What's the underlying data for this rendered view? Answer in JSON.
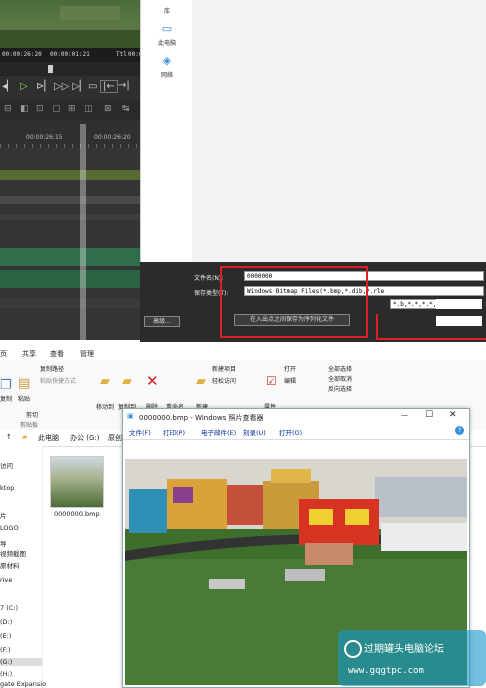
{
  "editor": {
    "timecodes": [
      "00:00:26:20",
      "00:00:01:21",
      "Ttl",
      "00:00:"
    ],
    "ruler_labels": [
      "00:00:26:15",
      "00:00:26:20"
    ]
  },
  "save_dialog": {
    "nav_items": [
      "库",
      "此电脑",
      "网络"
    ],
    "filename_label": "文件名(N):",
    "filename_value": "0000000",
    "filetype_label": "保存类型(T):",
    "filetype_value": "Windows Bitmap Files(*.bmp,*.dib,*.rle",
    "filter_value": "*.b,*.*,*.*,",
    "advanced_button": "高级...",
    "save_as_sequence_button": "在入出点之间保存为序列化文件"
  },
  "explorer": {
    "tabs": [
      "页",
      "共享",
      "查看",
      "管理"
    ],
    "clipboard": {
      "copy_path": "复制路径",
      "paste_shortcut": "粘贴快捷方式",
      "cut": "剪切",
      "copy": "复制",
      "paste": "粘贴",
      "group": "剪贴板"
    },
    "organize": {
      "move_to": "移动到",
      "copy_to": "复制到",
      "delete": "删除",
      "rename": "重命名"
    },
    "new_group": {
      "new": "新建",
      "new_item": "新建项目",
      "easy_access": "轻松访问"
    },
    "open_group": {
      "properties": "属性",
      "open": "打开",
      "edit": "编辑"
    },
    "select_group": {
      "select_all": "全部选择",
      "select_none": "全部取消",
      "invert": "反向选择"
    },
    "breadcrumb": [
      "此电脑",
      "办公 (G:)",
      "原创文"
    ],
    "nav_pane": [
      "访问",
      "ktop",
      "片",
      "LOGO",
      "导",
      "视频截图",
      "原材料",
      "",
      "rive",
      "",
      "7 (C:)",
      "(D:)",
      "(E:)",
      "(F:)",
      "(G:)",
      "(H:)",
      "gate Expansio"
    ],
    "file_name": "0000000.bmp"
  },
  "photo_viewer": {
    "title": "0000000.bmp - Windows 照片查看器",
    "menu": [
      "文件(F)",
      "打印(P)",
      "电子邮件(E)",
      "刻录(U)",
      "打开(O)"
    ],
    "help_glyph": "?"
  },
  "watermark": {
    "name": "过期罐头电脑论坛",
    "url": "www.gqgtpc.com"
  }
}
